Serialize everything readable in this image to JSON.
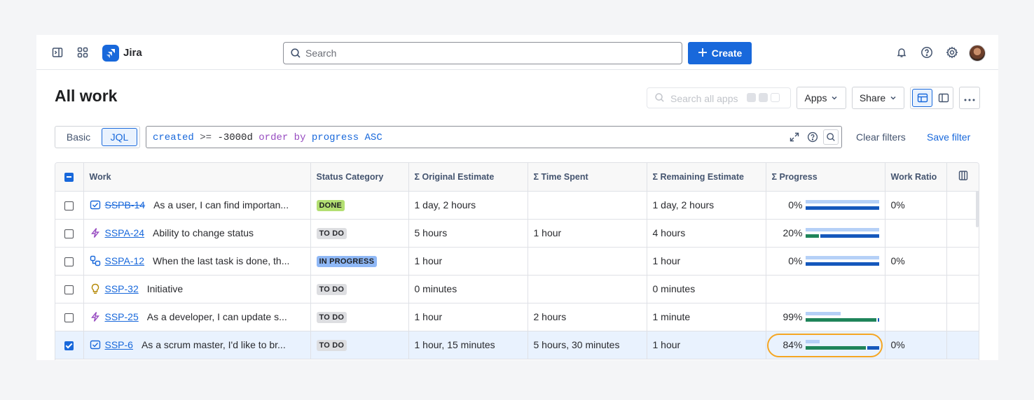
{
  "nav": {
    "app_name": "Jira",
    "search_placeholder": "Search",
    "create_label": "Create"
  },
  "header": {
    "title": "All work",
    "apps_search_placeholder": "Search all apps",
    "apps_label": "Apps",
    "share_label": "Share"
  },
  "filter": {
    "basic_label": "Basic",
    "jql_label": "JQL",
    "jql_tokens": {
      "field": "created",
      "op": ">=",
      "value": "-3000d",
      "kw": "order by",
      "sort_field": "progress",
      "dir": "ASC"
    },
    "clear_filters": "Clear filters",
    "save_filter": "Save filter"
  },
  "table": {
    "columns": [
      "Work",
      "Status Category",
      "Σ Original Estimate",
      "Σ Time Spent",
      "Σ Remaining Estimate",
      "Σ Progress",
      "Work Ratio"
    ],
    "rows": [
      {
        "icon": "task",
        "key": "SSPB-14",
        "key_done": true,
        "summary": "As a user, I can find importan...",
        "status": "DONE",
        "original": "1 day, 2 hours",
        "spent": "",
        "remaining": "1 day, 2 hours",
        "progress": "0%",
        "progress_value": 0,
        "ratio": "0%",
        "selected": false
      },
      {
        "icon": "epic",
        "key": "SSPA-24",
        "key_done": false,
        "summary": "Ability to change status",
        "status": "TO DO",
        "original": "5 hours",
        "spent": "1 hour",
        "remaining": "4 hours",
        "progress": "20%",
        "progress_value": 20,
        "ratio": "",
        "selected": false
      },
      {
        "icon": "subtask",
        "key": "SSPA-12",
        "key_done": false,
        "summary": "When the last task is done, th...",
        "status": "IN PROGRESS",
        "original": "1 hour",
        "spent": "",
        "remaining": "1 hour",
        "progress": "0%",
        "progress_value": 0,
        "ratio": "0%",
        "selected": false
      },
      {
        "icon": "idea",
        "key": "SSP-32",
        "key_done": false,
        "summary": "Initiative",
        "status": "TO DO",
        "original": "0 minutes",
        "spent": "",
        "remaining": "0 minutes",
        "progress": "",
        "progress_value": null,
        "ratio": "",
        "selected": false
      },
      {
        "icon": "epic",
        "key": "SSP-25",
        "key_done": false,
        "summary": "As a developer, I can update s...",
        "status": "TO DO",
        "original": "1 hour",
        "spent": "2 hours",
        "remaining": "1 minute",
        "progress": "99%",
        "progress_value": 99,
        "ratio": "",
        "selected": false
      },
      {
        "icon": "task",
        "key": "SSP-6",
        "key_done": false,
        "summary": "As a scrum master, I'd like to br...",
        "status": "TO DO",
        "original": "1 hour, 15 minutes",
        "spent": "5 hours, 30 minutes",
        "remaining": "1 hour",
        "progress": "84%",
        "progress_value": 84,
        "ratio": "0%",
        "selected": true
      }
    ]
  },
  "colors": {
    "brand": "#1868db",
    "done_lozenge": "#b3df72",
    "inprogress_lozenge": "#8fb8f6",
    "progress_done": "#1f845a",
    "progress_remaining": "#1558bc",
    "progress_estimate": "#b5d0f7",
    "highlight": "#f5a623"
  }
}
